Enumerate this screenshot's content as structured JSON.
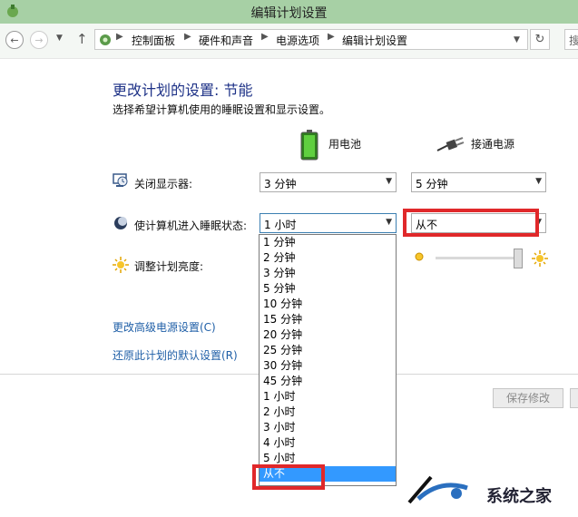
{
  "window": {
    "title": "编辑计划设置"
  },
  "breadcrumb": [
    "控制面板",
    "硬件和声音",
    "电源选项",
    "编辑计划设置"
  ],
  "search": {
    "placeholder": "搜"
  },
  "main": {
    "heading": "更改计划的设置: 节能",
    "subheading": "选择希望计算机使用的睡眠设置和显示设置。",
    "columns": {
      "battery": "用电池",
      "plugged": "接通电源"
    },
    "rows": {
      "display": {
        "label": "关闭显示器:",
        "battery_value": "3 分钟",
        "plugged_value": "5 分钟"
      },
      "sleep": {
        "label": "使计算机进入睡眠状态:",
        "battery_value": "1 小时",
        "plugged_value": "从不"
      },
      "brightness": {
        "label": "调整计划亮度:",
        "plugged_level": 1.0
      }
    },
    "links": {
      "advanced": "更改高级电源设置(C)",
      "restore": "还原此计划的默认设置(R)"
    },
    "save_label": "保存修改"
  },
  "dropdown_options": [
    "1 分钟",
    "2 分钟",
    "3 分钟",
    "5 分钟",
    "10 分钟",
    "15 分钟",
    "20 分钟",
    "25 分钟",
    "30 分钟",
    "45 分钟",
    "1 小时",
    "2 小时",
    "3 小时",
    "4 小时",
    "5 小时",
    "从不"
  ],
  "dropdown_selected": "从不",
  "watermark": {
    "text": "系统之家"
  },
  "colors": {
    "accent": "#3399ff",
    "highlight": "#e0282a",
    "titlebar": "#a7d0a5",
    "link": "#1f5fa7"
  }
}
